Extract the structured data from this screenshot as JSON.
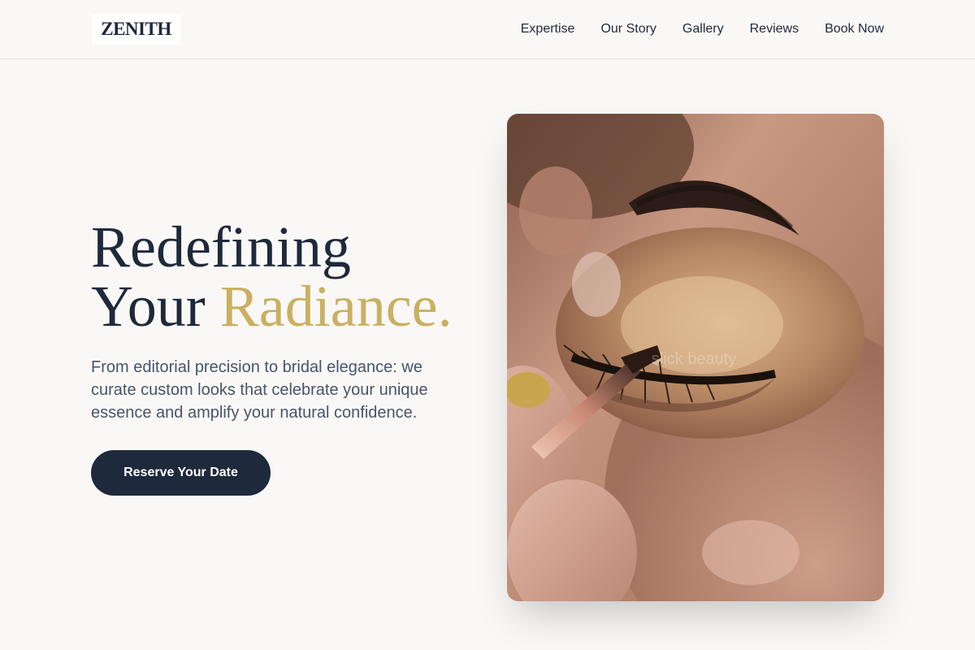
{
  "header": {
    "logo": "ZENITH",
    "nav": [
      {
        "label": "Expertise"
      },
      {
        "label": "Our Story"
      },
      {
        "label": "Gallery"
      },
      {
        "label": "Reviews"
      },
      {
        "label": "Book Now"
      }
    ]
  },
  "hero": {
    "title_line1": "Redefining",
    "title_line2_plain": "Your ",
    "title_line2_accent": "Radiance.",
    "description": "From editorial precision to bridal elegance: we curate custom looks that celebrate your unique essence and amplify your natural confidence.",
    "cta_label": "Reserve Your Date",
    "image_watermark": "slick beauty"
  },
  "colors": {
    "primary": "#1e293b",
    "accent": "#c9b061",
    "background": "#faf8f6",
    "body_text": "#475569"
  }
}
